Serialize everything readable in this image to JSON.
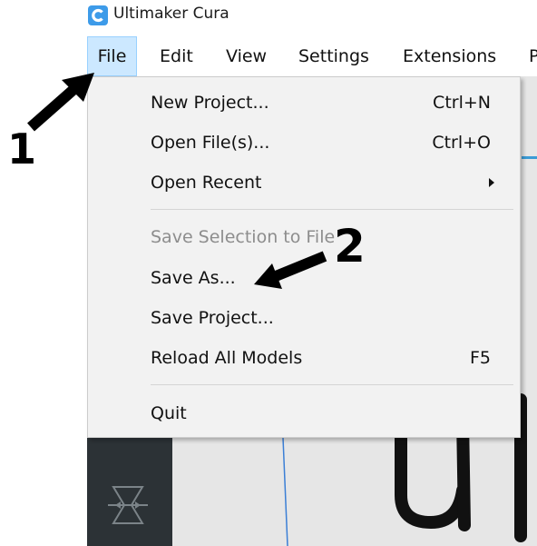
{
  "window": {
    "title": "Ultimaker Cura"
  },
  "menubar": {
    "items": [
      "File",
      "Edit",
      "View",
      "Settings",
      "Extensions",
      "P"
    ]
  },
  "file_menu": {
    "items": [
      {
        "label": "New Project...",
        "shortcut": "Ctrl+N",
        "enabled": true
      },
      {
        "label": "Open File(s)...",
        "shortcut": "Ctrl+O",
        "enabled": true
      },
      {
        "label": "Open Recent",
        "shortcut": "",
        "submenu": true,
        "enabled": true
      },
      {
        "label": "Save Selection to File",
        "shortcut": "",
        "enabled": false
      },
      {
        "label": "Save As...",
        "shortcut": "",
        "enabled": true
      },
      {
        "label": "Save Project...",
        "shortcut": "",
        "enabled": true
      },
      {
        "label": "Reload All Models",
        "shortcut": "F5",
        "enabled": true
      },
      {
        "label": "Quit",
        "shortcut": "",
        "enabled": true
      }
    ]
  },
  "annotations": {
    "step1": "1",
    "step2": "2"
  },
  "canvas_text": "ul",
  "colors": {
    "menu_highlight": "#cce8ff",
    "logo_blue": "#3d9be9",
    "dark_toolbar": "#2c3236"
  }
}
